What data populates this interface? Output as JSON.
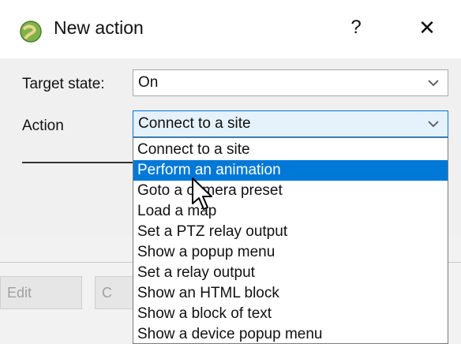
{
  "dialog": {
    "title": "New action",
    "help_label": "?",
    "close_label": "✕",
    "icon": "globe-icon"
  },
  "form": {
    "target_state_label": "Target state:",
    "target_state_value": "On",
    "action_label": "Action",
    "action_value": "Connect to a site"
  },
  "dropdown": {
    "items": [
      "Connect to a site",
      "Perform an animation",
      "Goto a camera preset",
      "Load a map",
      "Set a PTZ relay output",
      "Show a popup menu",
      "Set a relay output",
      "Show an HTML block",
      "Show a block of text",
      "Show a device popup menu"
    ],
    "highlighted": "Perform an animation"
  },
  "background_buttons": {
    "edit_label": "Edit",
    "second_label": "C"
  },
  "colors": {
    "accent": "#0078d7",
    "combo_focus_bg": "#e5f1fb"
  }
}
